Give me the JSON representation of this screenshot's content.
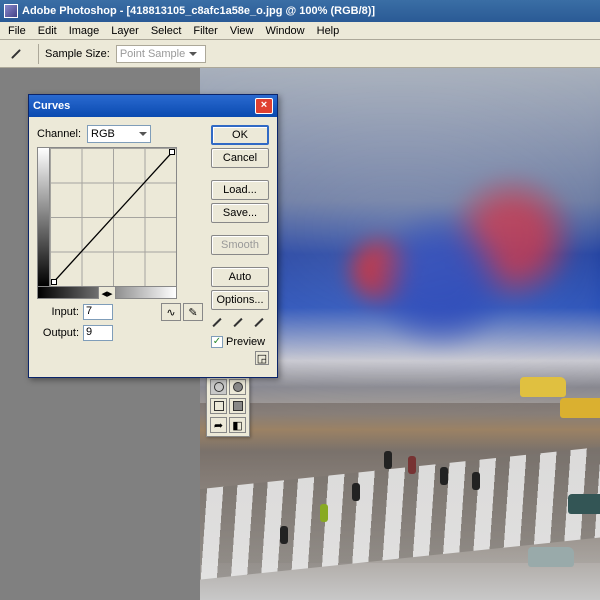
{
  "titlebar": {
    "text": "Adobe Photoshop - [418813105_c8afc1a58e_o.jpg @ 100% (RGB/8)]"
  },
  "menu": {
    "items": [
      "File",
      "Edit",
      "Image",
      "Layer",
      "Select",
      "Filter",
      "View",
      "Window",
      "Help"
    ]
  },
  "optionsbar": {
    "sample_label": "Sample Size:",
    "sample_value": "Point Sample"
  },
  "dialog": {
    "title": "Curves",
    "channel_label": "Channel:",
    "channel_value": "RGB",
    "input_label": "Input:",
    "input_value": "7",
    "output_label": "Output:",
    "output_value": "9",
    "buttons": {
      "ok": "OK",
      "cancel": "Cancel",
      "load": "Load...",
      "save": "Save...",
      "smooth": "Smooth",
      "auto": "Auto",
      "options": "Options..."
    },
    "preview_label": "Preview",
    "eyedroppers": [
      "black-point",
      "gray-point",
      "white-point"
    ]
  }
}
